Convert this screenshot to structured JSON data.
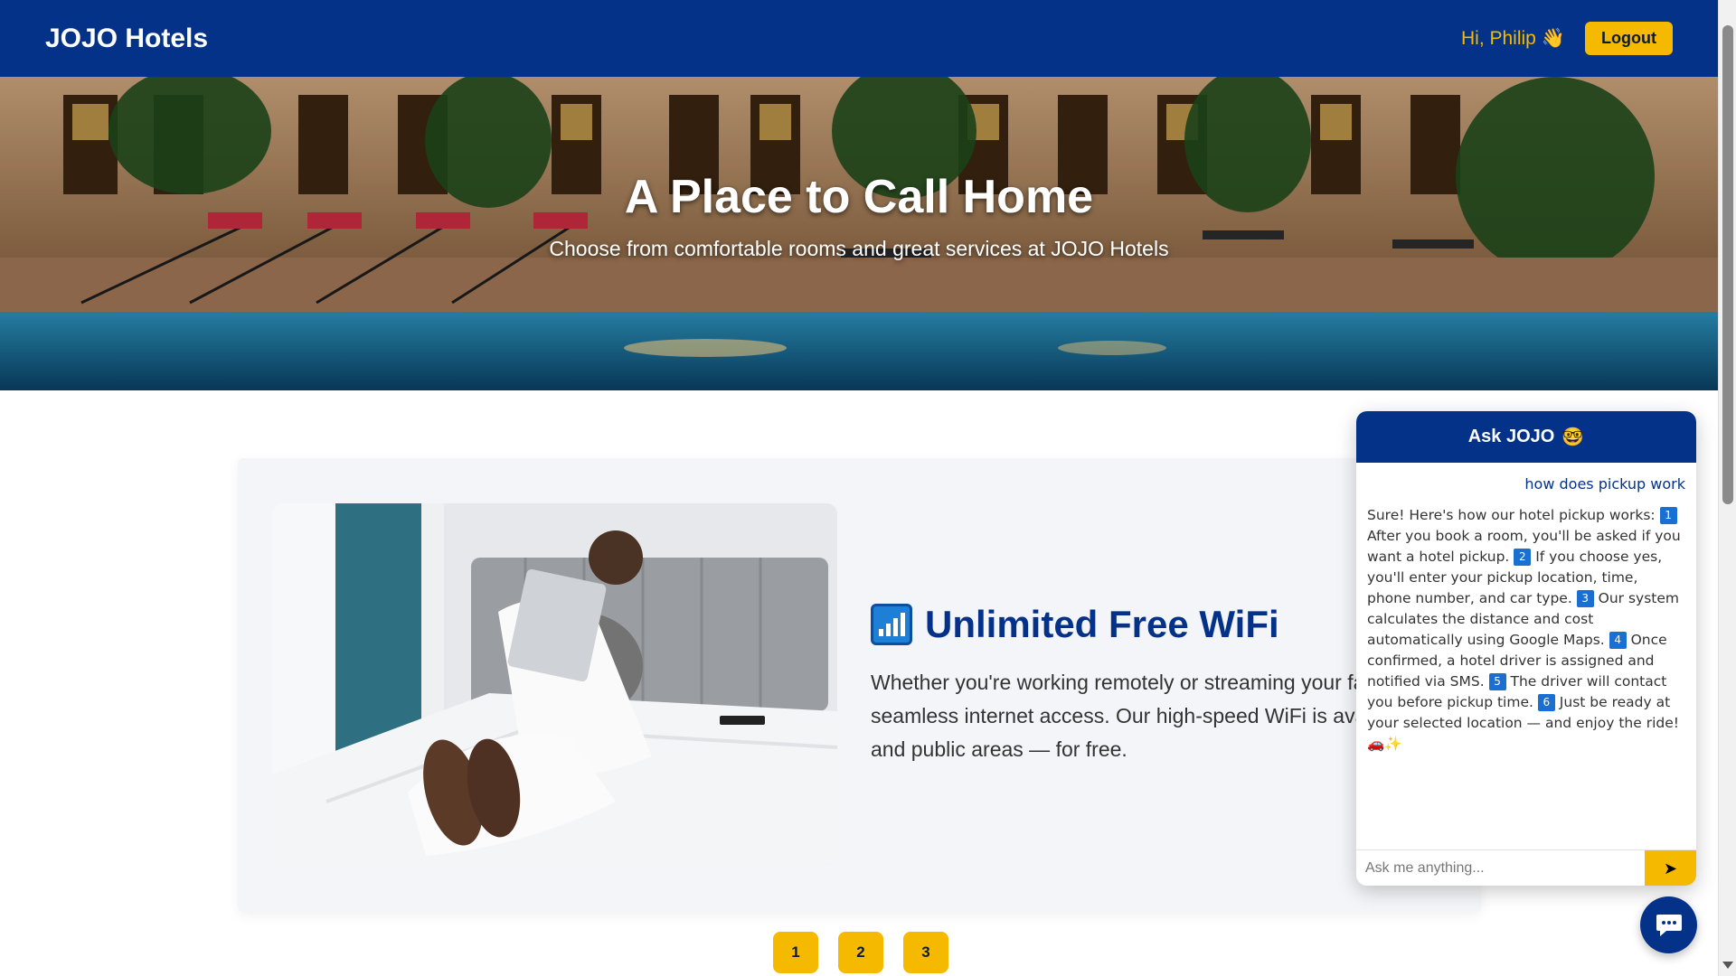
{
  "navbar": {
    "brand": "JOJO Hotels",
    "greeting": "Hi, Philip",
    "greeting_emoji": "👋",
    "logout_label": "Logout"
  },
  "hero": {
    "title": "A Place to Call Home",
    "subtitle": "Choose from comfortable rooms and great services at JOJO Hotels"
  },
  "feature": {
    "icon": "wifi-signal-icon",
    "title": "Unlimited Free WiFi",
    "description": "Whether you're working remotely or streaming your favorite shows, enjoy seamless internet access. Our high-speed WiFi is available in all rooms and public areas — for free."
  },
  "pagination": {
    "pages": [
      "1",
      "2",
      "3"
    ]
  },
  "chat": {
    "title": "Ask JOJO",
    "title_icon": "🤓",
    "user_message": "how does pickup work",
    "bot_intro": "Sure! Here's how our hotel pickup works:",
    "steps": [
      {
        "n": "1",
        "text": "After you book a room, you'll be asked if you want a hotel pickup."
      },
      {
        "n": "2",
        "text": "If you choose yes, you'll enter your pickup location, time, phone number, and car type."
      },
      {
        "n": "3",
        "text": "Our system calculates the distance and cost automatically using Google Maps."
      },
      {
        "n": "4",
        "text": "Once confirmed, a hotel driver is assigned and notified via SMS."
      },
      {
        "n": "5",
        "text": "The driver will contact you before pickup time."
      },
      {
        "n": "6",
        "text": "Just be ready at your selected location — and enjoy the ride!"
      }
    ],
    "bot_outro": "🚗✨",
    "input_placeholder": "Ask me anything...",
    "send_label": "➤"
  },
  "colors": {
    "primary": "#053289",
    "accent": "#f5b900",
    "card_bg": "#f4f5f8"
  }
}
